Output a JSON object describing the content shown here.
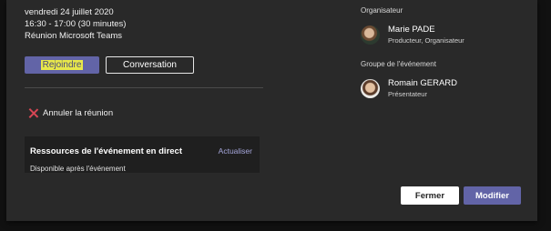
{
  "meeting": {
    "date": "vendredi 24 juillet 2020",
    "time": "16:30 - 17:00 (30 minutes)",
    "platform": "Réunion Microsoft Teams"
  },
  "actions": {
    "join_label": "Rejoindre",
    "conversation_label": "Conversation",
    "cancel_label": "Annuler la réunion"
  },
  "resources": {
    "title": "Ressources de l'événement en direct",
    "refresh_label": "Actualiser",
    "availability": "Disponible après l'événement"
  },
  "organizer": {
    "section_label": "Organisateur",
    "name": "Marie PADE",
    "role": "Producteur, Organisateur"
  },
  "event_group": {
    "section_label": "Groupe de l'événement",
    "name": "Romain GERARD",
    "role": "Présentateur"
  },
  "footer": {
    "close_label": "Fermer",
    "edit_label": "Modifier"
  },
  "colors": {
    "accent": "#6264a7",
    "highlight": "#e8e84a",
    "cancel_icon": "#d74654",
    "panel_bg": "#292929"
  }
}
